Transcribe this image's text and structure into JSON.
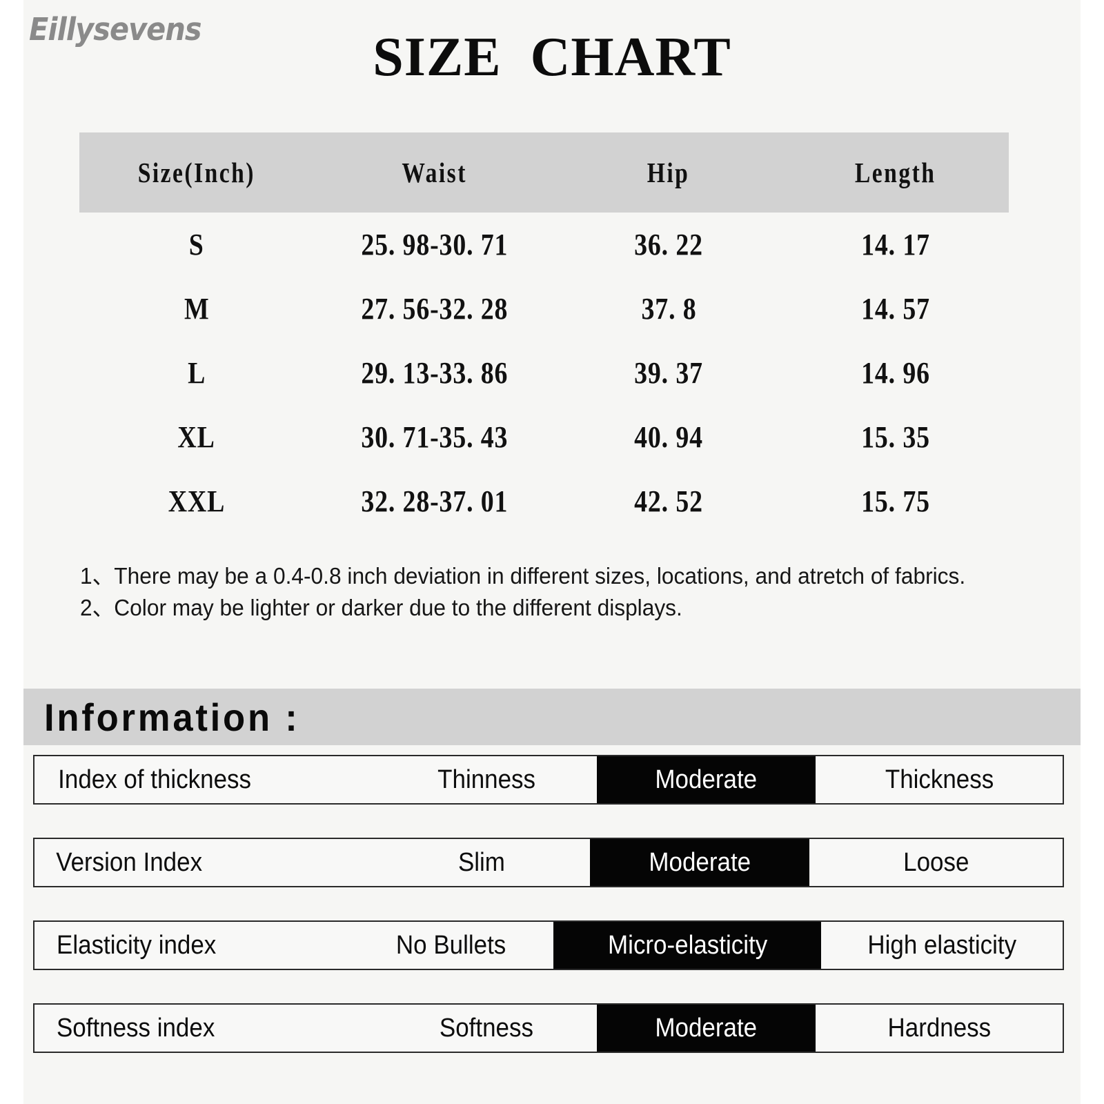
{
  "brand": {
    "name": "Eillysevens"
  },
  "header": {
    "title": "SIZE  CHART"
  },
  "size_table": {
    "columns": [
      "Size(Inch)",
      "Waist",
      "Hip",
      "Length"
    ],
    "rows": [
      {
        "size": "S",
        "waist": "25. 98-30. 71",
        "hip": "36. 22",
        "length": "14. 17"
      },
      {
        "size": "M",
        "waist": "27. 56-32. 28",
        "hip": "37. 8",
        "length": "14. 57"
      },
      {
        "size": "L",
        "waist": "29. 13-33. 86",
        "hip": "39. 37",
        "length": "14. 96"
      },
      {
        "size": "XL",
        "waist": "30. 71-35. 43",
        "hip": "40. 94",
        "length": "15. 35"
      },
      {
        "size": "XXL",
        "waist": "32. 28-37. 01",
        "hip": "42. 52",
        "length": "15. 75"
      }
    ]
  },
  "notes": [
    "1、There may be a 0.4-0.8 inch deviation in different sizes, locations, and atretch of fabrics.",
    "2、Color may be lighter or darker due to the different displays."
  ],
  "information": {
    "title": "Information :",
    "rows": [
      {
        "label": "Index of thickness",
        "option_low": "Thinness",
        "option_mid": "Moderate",
        "option_high": "Thickness",
        "selected": "option_mid"
      },
      {
        "label": "Version Index",
        "option_low": "Slim",
        "option_mid": "Moderate",
        "option_high": "Loose",
        "selected": "option_mid"
      },
      {
        "label": "Elasticity index",
        "option_low": "No Bullets",
        "option_mid": "Micro-elasticity",
        "option_high": "High elasticity",
        "selected": "option_mid"
      },
      {
        "label": "Softness index",
        "option_low": "Softness",
        "option_mid": "Moderate",
        "option_high": "Hardness",
        "selected": "option_mid"
      }
    ]
  },
  "colors": {
    "page_background": "#ffffff",
    "panel_background": "#f6f6f4",
    "band_gray": "#d2d2d2",
    "selected_background": "#050505",
    "selected_text": "#ffffff",
    "text": "#111111",
    "brand_gray": "#8a8a8a"
  }
}
